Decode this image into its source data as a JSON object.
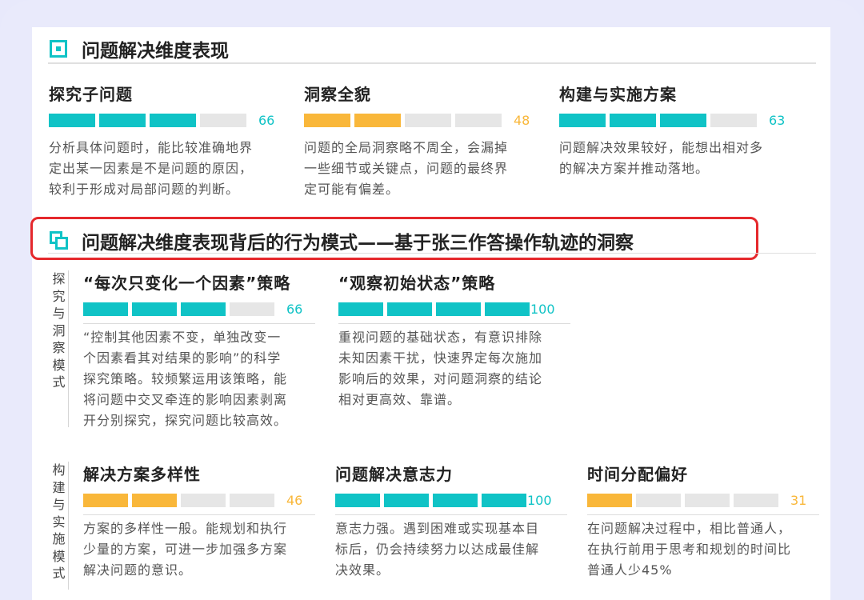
{
  "section1": {
    "title": "问题解决维度表现",
    "items": [
      {
        "title": "探究子问题",
        "score": "66",
        "filled": 3,
        "color": "#10c3c6",
        "desc": [
          "分析具体问题时，能比较准确地界",
          "定出某一因素是不是问题的原因，",
          "较利于形成对局部问题的判断。"
        ]
      },
      {
        "title": "洞察全貌",
        "score": "48",
        "filled": 2,
        "color": "#f9b73a",
        "desc": [
          "问题的全局洞察略不周全，会漏掉",
          "一些细节或关键点，问题的最终界",
          "定可能有偏差。"
        ]
      },
      {
        "title": "构建与实施方案",
        "score": "63",
        "filled": 3,
        "color": "#10c3c6",
        "desc": [
          "问题解决效果较好，能想出相对多",
          "的解决方案并推动落地。"
        ]
      }
    ]
  },
  "section2": {
    "title": "问题解决维度表现背后的行为模式——基于张三作答操作轨迹的洞察",
    "group1_label": [
      "探",
      "究",
      "与",
      "洞",
      "察",
      "模",
      "式"
    ],
    "group1": [
      {
        "title": "“每次只变化一个因素”策略",
        "score": "66",
        "filled": 3,
        "color": "#10c3c6",
        "desc": [
          "“控制其他因素不变，单独改变一",
          "个因素看其对结果的影响”的科学",
          "探究策略。较频繁运用该策略，能",
          "将问题中交叉牵连的影响因素剥离",
          "开分别探究，探究问题比较高效。"
        ]
      },
      {
        "title": "“观察初始状态”策略",
        "score": "100",
        "filled": 4,
        "color": "#10c3c6",
        "desc": [
          "重视问题的基础状态，有意识排除",
          "未知因素干扰，快速界定每次施加",
          "影响后的效果，对问题洞察的结论",
          "相对更高效、靠谱。"
        ]
      }
    ],
    "group2_label": [
      "构",
      "建",
      "与",
      "实",
      "施",
      "模",
      "式"
    ],
    "group2": [
      {
        "title": "解决方案多样性",
        "score": "46",
        "filled": 2,
        "color": "#f9b73a",
        "desc": [
          "方案的多样性一般。能规划和执行",
          "少量的方案，可进一步加强多方案",
          "解决问题的意识。"
        ]
      },
      {
        "title": "问题解决意志力",
        "score": "100",
        "filled": 4,
        "color": "#10c3c6",
        "desc": [
          "意志力强。遇到困难或实现基本目",
          "标后，仍会持续努力以达成最佳解",
          "决效果。"
        ]
      },
      {
        "title": "时间分配偏好",
        "score": "31",
        "filled": 1,
        "color": "#f9b73a",
        "desc": [
          "在问题解决过程中，相比普通人，",
          "在执行前用于思考和规划的时间比",
          "普通人少45%"
        ]
      }
    ]
  }
}
